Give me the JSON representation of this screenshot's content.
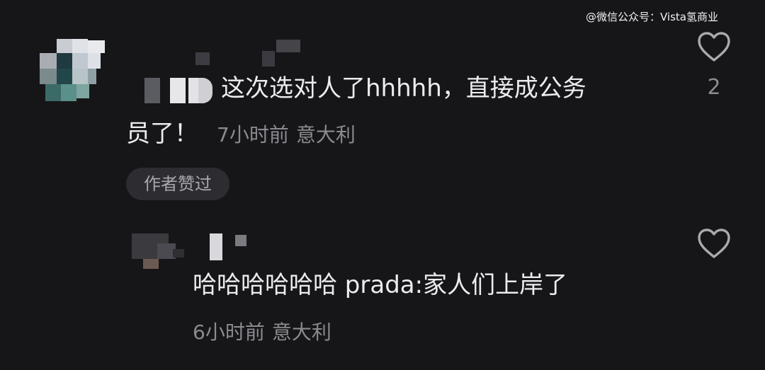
{
  "watermark": "@微信公众号：Vista氢商业",
  "comments": [
    {
      "text_line1": "这次选对人了hhhhh，直接成公务",
      "text_line2": "员了！",
      "time": "7小时前",
      "location": "意大利",
      "badge": "作者赞过",
      "likes": "2",
      "like_icon": "heart-outline-icon"
    },
    {
      "text": "哈哈哈哈哈哈 prada:家人们上岸了",
      "time": "6小时前",
      "location": "意大利",
      "like_icon": "heart-outline-icon"
    }
  ],
  "colors": {
    "background": "#161619",
    "text": "#ececef",
    "meta": "#8a8a90",
    "badge_bg": "#2c2c31"
  }
}
